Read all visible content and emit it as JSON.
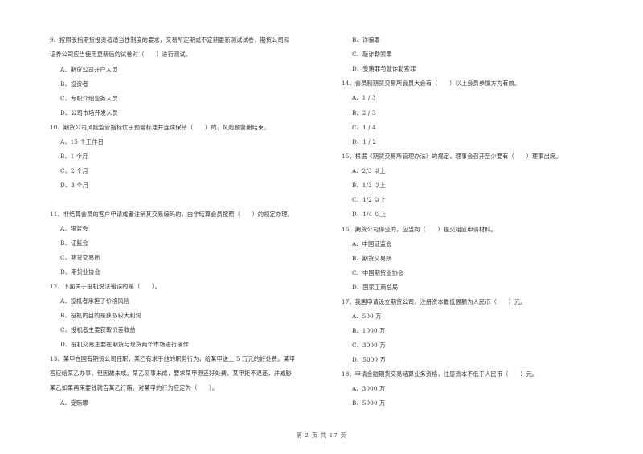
{
  "page": {
    "footer": "第 2 页 共 17 页"
  },
  "left_column": [
    {
      "kind": "q",
      "text": "9、按照股指期货投资者适当性制度的要求，交易所定期或不定期更新测试试卷，期货公司和"
    },
    {
      "kind": "q",
      "text": "证券公司应当使用更新后的试卷对（　　）进行测试。"
    },
    {
      "kind": "o",
      "text": "A、期货公司开户人员"
    },
    {
      "kind": "o",
      "text": "B、投资者"
    },
    {
      "kind": "o",
      "text": "C、专职介绍业务人员"
    },
    {
      "kind": "o",
      "text": "D、公司市场开发人员"
    },
    {
      "kind": "q",
      "text": "10、期货公司风险监管指标优于预警标准并连续保持（　　）的，风险预警期结束。"
    },
    {
      "kind": "o",
      "text": "A、15 个工作日"
    },
    {
      "kind": "o",
      "text": "B、1 个月"
    },
    {
      "kind": "o",
      "text": "C、2 个月"
    },
    {
      "kind": "o",
      "text": "D、3 个月"
    },
    {
      "kind": "q",
      "text": "11、非结算会员的客户申请或者注销其交易编码的，由非结算会员按照（　　）的规定办理。"
    },
    {
      "kind": "o",
      "text": "A、银监会"
    },
    {
      "kind": "o",
      "text": "B、证监会"
    },
    {
      "kind": "o",
      "text": "C、期货交易所"
    },
    {
      "kind": "o",
      "text": "D、期货业协会"
    },
    {
      "kind": "q",
      "text": "12、下面关于投机说法错误的是（　　）。"
    },
    {
      "kind": "o",
      "text": "A、投机者承担了价格风险"
    },
    {
      "kind": "o",
      "text": "B、投机的目的是获取较大利润"
    },
    {
      "kind": "o",
      "text": "C、投机者主要获取价差收益"
    },
    {
      "kind": "o",
      "text": "D、投机交易主要在期货与现货两个市场进行操作"
    },
    {
      "kind": "q",
      "text": "13、某甲在国有期货公司任职，某乙有求于他的职务行为，给某甲送上 5 万元的好处费。某甲"
    },
    {
      "kind": "q",
      "text": "答应给某乙办事，但因故未成。某乙见事未成，要求某甲退还好处费，某甲拒不退还，并威胁"
    },
    {
      "kind": "q",
      "text": "某乙如果再来要钱就告某乙行贿。对某甲的行为应定为（　　）。"
    },
    {
      "kind": "o",
      "text": "A、受贿罪"
    }
  ],
  "right_column": [
    {
      "kind": "o",
      "text": "B、诈骗罪"
    },
    {
      "kind": "o",
      "text": "C、敲诈勒索罪"
    },
    {
      "kind": "o",
      "text": "D、受贿罪与敲诈勒索罪"
    },
    {
      "kind": "q",
      "text": "14、会员制期货交易所会员大会有（　　）以上会员参加方为有效。"
    },
    {
      "kind": "o",
      "text": "A、1 / 3"
    },
    {
      "kind": "o",
      "text": "B、2 / 3"
    },
    {
      "kind": "o",
      "text": "C、1 / 4"
    },
    {
      "kind": "o",
      "text": "D、1 / 2"
    },
    {
      "kind": "q",
      "text": "15、根据《期货交易所管理办法》的规定，理事会召开至少要有（　　）理事出席。"
    },
    {
      "kind": "o",
      "text": "A、2/3 以上"
    },
    {
      "kind": "o",
      "text": "B、1/3 以上"
    },
    {
      "kind": "o",
      "text": "C、1/2 以上"
    },
    {
      "kind": "o",
      "text": "D、1/4 以上"
    },
    {
      "kind": "q",
      "text": "16、期货公司停业的，应当向（　　）提交相应申请材料。"
    },
    {
      "kind": "o",
      "text": "A、中国证监会"
    },
    {
      "kind": "o",
      "text": "B、期货交易所"
    },
    {
      "kind": "o",
      "text": "C、中国期货业协会"
    },
    {
      "kind": "o",
      "text": "D、国家工商总局"
    },
    {
      "kind": "q",
      "text": "17、我国申请设立期货公司，注册资本最低限额为人民币（　　）元。"
    },
    {
      "kind": "o",
      "text": "A、500 万"
    },
    {
      "kind": "o",
      "text": "B、1000 万"
    },
    {
      "kind": "o",
      "text": "C、3000 万"
    },
    {
      "kind": "o",
      "text": "D、5000 万"
    },
    {
      "kind": "q",
      "text": "18、申请金融期货交易结算业务资格，注册资本不低于人民币（　　）元。"
    },
    {
      "kind": "o",
      "text": "A、3000 万"
    },
    {
      "kind": "o",
      "text": "B、5000 万"
    }
  ]
}
